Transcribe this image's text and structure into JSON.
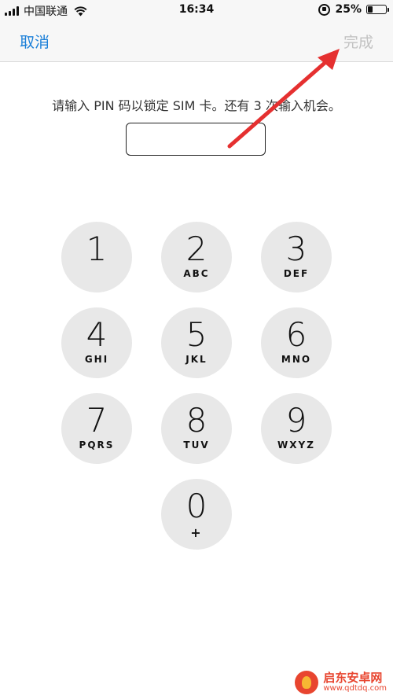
{
  "status_bar": {
    "carrier": "中国联通",
    "time": "16:34",
    "battery_text": "25%",
    "battery_level": 0.25,
    "icons": [
      "signal-bars-icon",
      "wifi-icon",
      "orientation-lock-icon",
      "battery-icon"
    ]
  },
  "nav": {
    "cancel_label": "取消",
    "done_label": "完成",
    "accent_color": "#1a7fd8",
    "disabled_color": "#c2c2c2"
  },
  "prompt": "请输入 PIN 码以锁定 SIM 卡。还有 3 次输入机会。",
  "pin_input": {
    "value": "",
    "placeholder": ""
  },
  "keypad": {
    "keys": [
      {
        "digit": "1",
        "letters": ""
      },
      {
        "digit": "2",
        "letters": "ABC"
      },
      {
        "digit": "3",
        "letters": "DEF"
      },
      {
        "digit": "4",
        "letters": "GHI"
      },
      {
        "digit": "5",
        "letters": "JKL"
      },
      {
        "digit": "6",
        "letters": "MNO"
      },
      {
        "digit": "7",
        "letters": "PQRS"
      },
      {
        "digit": "8",
        "letters": "TUV"
      },
      {
        "digit": "9",
        "letters": "WXYZ"
      },
      {
        "digit": "0",
        "letters": "+"
      }
    ]
  },
  "annotation": {
    "arrow_color": "#e53030"
  },
  "watermark": {
    "brand": "启东安卓网",
    "url": "www.qdtdq.com"
  }
}
